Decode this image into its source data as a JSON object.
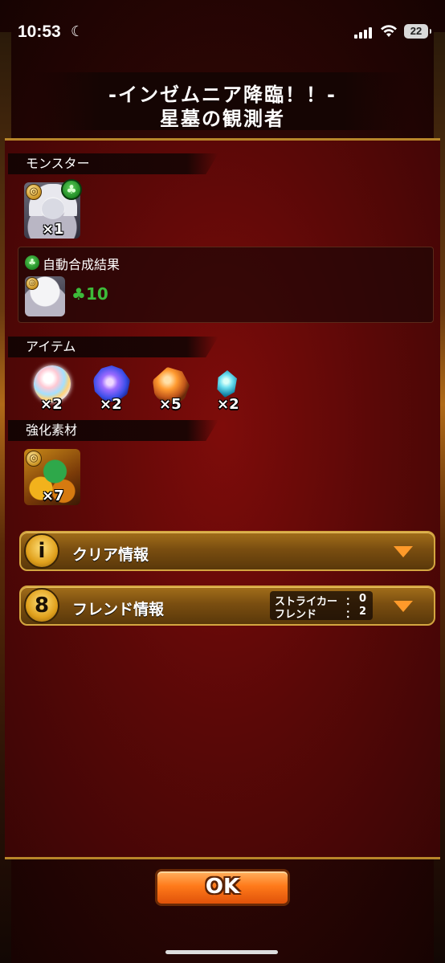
{
  "status_bar": {
    "time": "10:53",
    "battery": "22"
  },
  "title": {
    "line1": "-インゼムニア降臨！！-",
    "line2": "星墓の観測者"
  },
  "sections": {
    "monster": "モンスター",
    "items": "アイテム",
    "materials": "強化素材"
  },
  "monster": {
    "count": "×1"
  },
  "auto_synthesis": {
    "title": "自動合成結果",
    "value": "10"
  },
  "items": [
    {
      "icon": "rainbow-orb-icon",
      "count": "×2"
    },
    {
      "icon": "blue-crystal-icon",
      "count": "×2"
    },
    {
      "icon": "orange-crystal-icon",
      "count": "×5"
    },
    {
      "icon": "cyan-crystal-icon",
      "count": "×2"
    }
  ],
  "material": {
    "count": "×7"
  },
  "clear_info": {
    "label": "クリア情報"
  },
  "friend_info": {
    "label": "フレンド情報",
    "striker_label": "ストライカー",
    "striker_value": "0",
    "friend_label": "フレンド",
    "friend_value": "2"
  },
  "ok_button": "OK",
  "colors": {
    "panel_red": "#6e0a08",
    "gold_border": "#b8862a",
    "clover_green": "#3dbb3a",
    "ok_orange": "#ff7a1a"
  }
}
